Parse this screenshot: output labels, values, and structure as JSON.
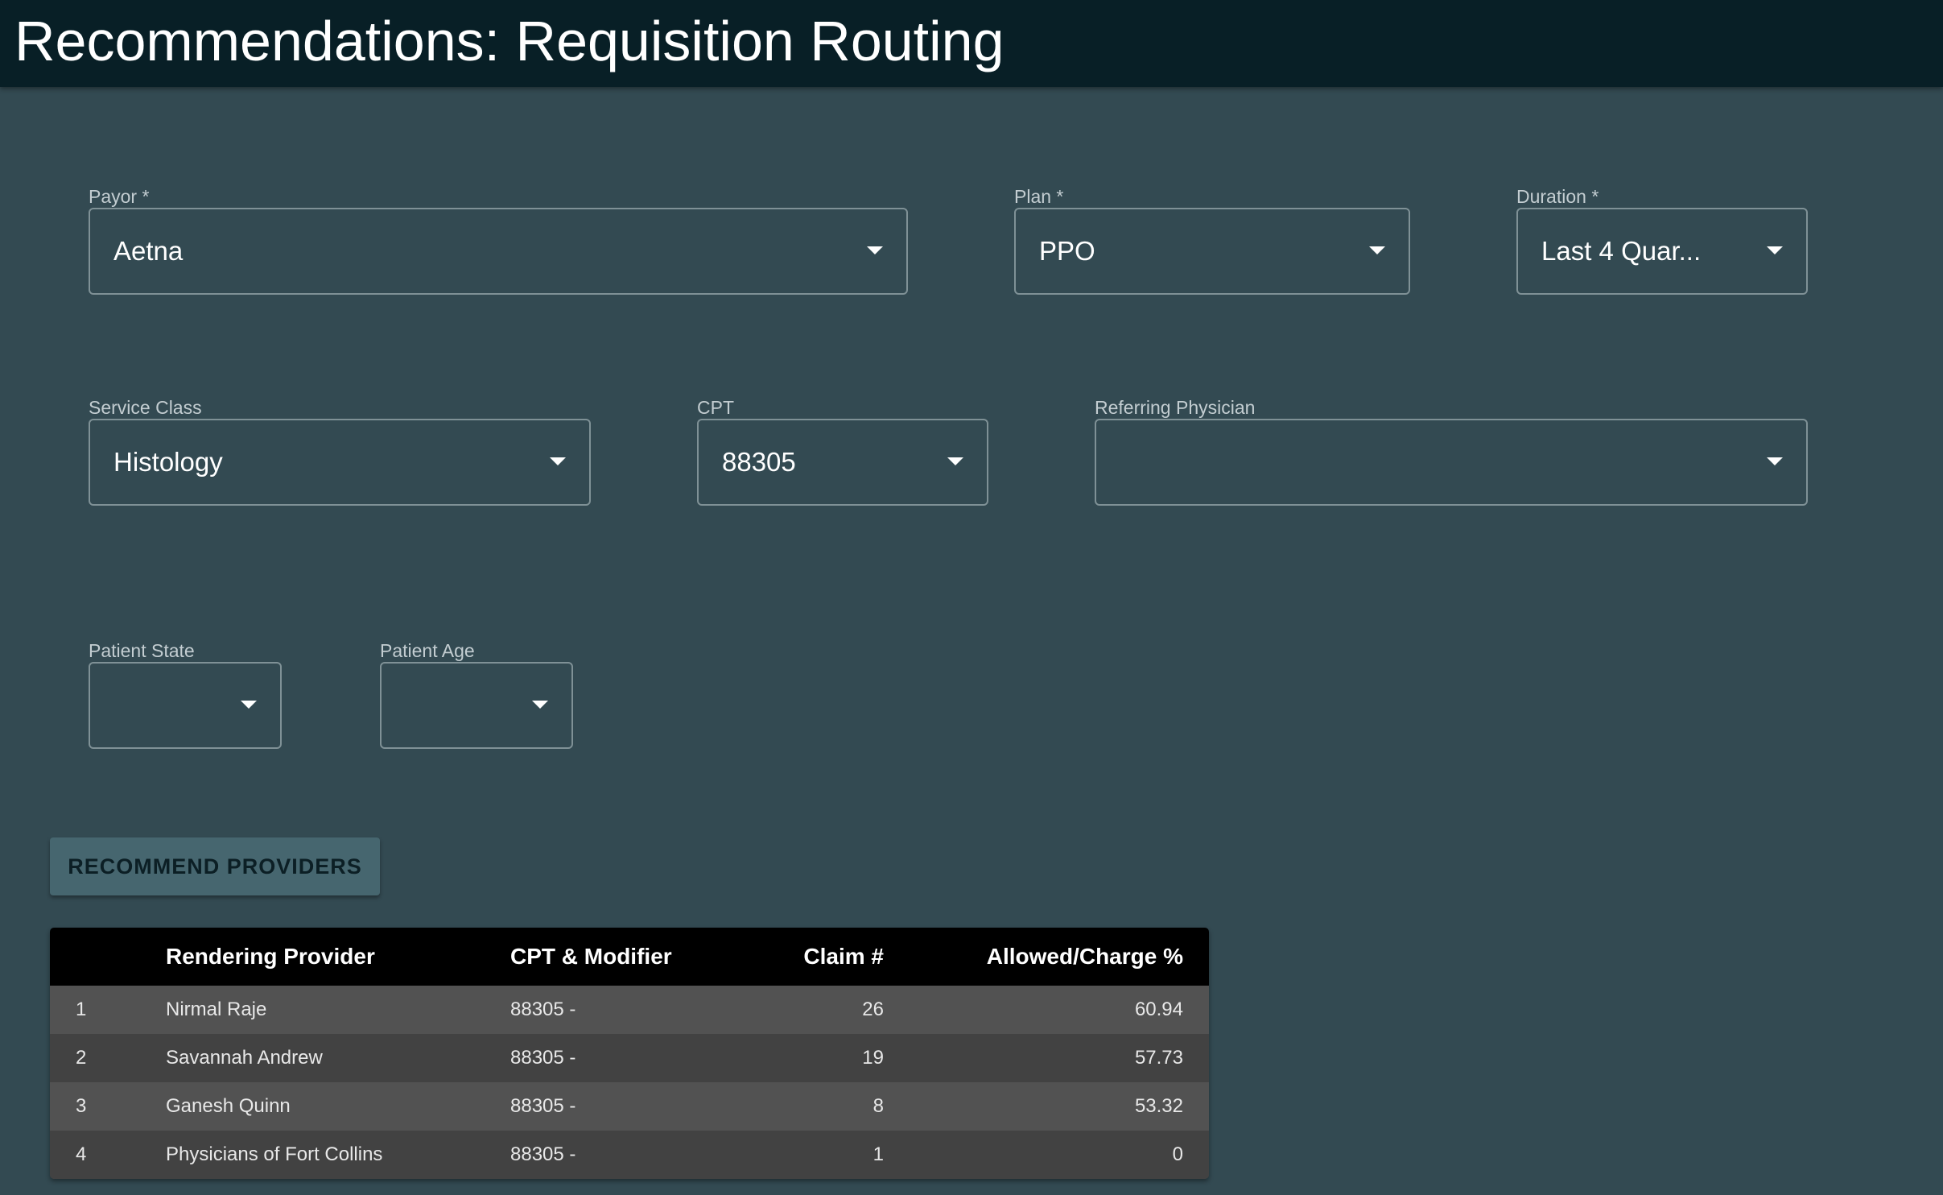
{
  "header": {
    "title": "Recommendations: Requisition Routing"
  },
  "filters": {
    "payor": {
      "label": "Payor *",
      "value": "Aetna"
    },
    "plan": {
      "label": "Plan *",
      "value": "PPO"
    },
    "duration": {
      "label": "Duration *",
      "value": "Last 4 Quar..."
    },
    "service_class": {
      "label": "Service Class",
      "value": "Histology"
    },
    "cpt": {
      "label": "CPT",
      "value": "88305"
    },
    "referring_physician": {
      "label": "Referring Physician",
      "value": ""
    },
    "patient_state": {
      "label": "Patient State",
      "value": ""
    },
    "patient_age": {
      "label": "Patient Age",
      "value": ""
    }
  },
  "actions": {
    "recommend_label": "RECOMMEND PROVIDERS"
  },
  "table": {
    "columns": [
      "",
      "Rendering Provider",
      "CPT & Modifier",
      "Claim #",
      "Allowed/Charge %"
    ],
    "rows": [
      [
        "1",
        "Nirmal Raje",
        "88305 -",
        "26",
        "60.94"
      ],
      [
        "2",
        "Savannah Andrew",
        "88305 -",
        "19",
        "57.73"
      ],
      [
        "3",
        "Ganesh Quinn",
        "88305 -",
        "8",
        "53.32"
      ],
      [
        "4",
        "Physicians of Fort Collins",
        "88305 -",
        "1",
        "0"
      ]
    ]
  },
  "icons": {
    "dropdown": "chevron-down-icon"
  }
}
